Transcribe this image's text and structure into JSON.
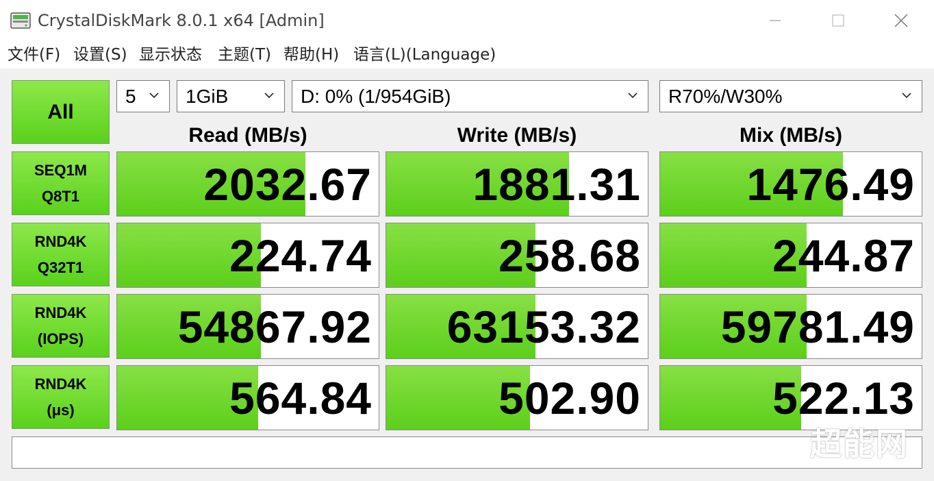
{
  "window": {
    "title": "CrystalDiskMark 8.0.1 x64 [Admin]"
  },
  "menu": {
    "items": [
      "文件(F)",
      "设置(S)",
      "显示状态",
      "主题(T)",
      "帮助(H)",
      "语言(L)(Language)"
    ]
  },
  "controls": {
    "all_label": "All",
    "runs": "5",
    "size": "1GiB",
    "drive": "D: 0% (1/954GiB)",
    "mix": "R70%/W30%"
  },
  "columns": [
    "Read (MB/s)",
    "Write (MB/s)",
    "Mix (MB/s)"
  ],
  "rows": [
    {
      "line1": "SEQ1M",
      "line2": "Q8T1",
      "values": [
        "2032.67",
        "1881.31",
        "1476.49"
      ],
      "bar_fraction": [
        0.72,
        0.7,
        0.7
      ]
    },
    {
      "line1": "RND4K",
      "line2": "Q32T1",
      "values": [
        "224.74",
        "258.68",
        "244.87"
      ],
      "bar_fraction": [
        0.55,
        0.57,
        0.56
      ]
    },
    {
      "line1": "RND4K",
      "line2": "(IOPS)",
      "values": [
        "54867.92",
        "63153.32",
        "59781.49"
      ],
      "bar_fraction": [
        0.55,
        0.57,
        0.56
      ]
    },
    {
      "line1": "RND4K",
      "line2": "(μs)",
      "values": [
        "564.84",
        "502.90",
        "522.13"
      ],
      "bar_fraction": [
        0.54,
        0.55,
        0.54
      ]
    }
  ],
  "status_text": "",
  "watermark": "超能网",
  "colors": {
    "accent_green": "#6ad82a"
  }
}
